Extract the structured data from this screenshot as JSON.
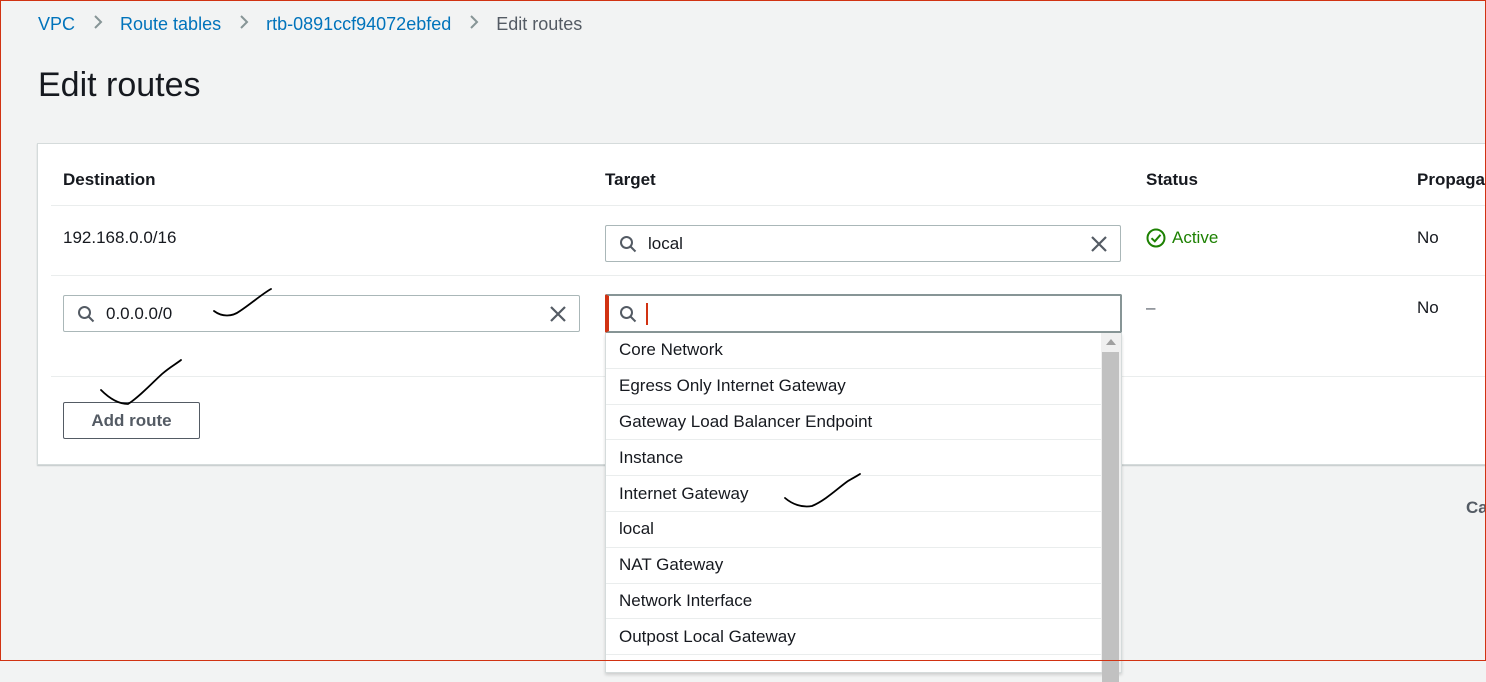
{
  "breadcrumb": {
    "items": [
      "VPC",
      "Route tables",
      "rtb-0891ccf94072ebfed"
    ],
    "current": "Edit routes"
  },
  "page": {
    "title": "Edit routes"
  },
  "table": {
    "headers": {
      "destination": "Destination",
      "target": "Target",
      "status": "Status",
      "propagated": "Propaga"
    },
    "rows": [
      {
        "destination": "192.168.0.0/16",
        "target": "local",
        "status": "Active",
        "propagated": "No"
      },
      {
        "destination": "0.0.0.0/0",
        "target": "",
        "status": "–",
        "propagated": "No"
      }
    ]
  },
  "buttons": {
    "add_route": "Add route",
    "cancel_partial": "Ca"
  },
  "dropdown": {
    "options": [
      "Core Network",
      "Egress Only Internet Gateway",
      "Gateway Load Balancer Endpoint",
      "Instance",
      "Internet Gateway",
      "local",
      "NAT Gateway",
      "Network Interface",
      "Outpost Local Gateway"
    ]
  },
  "colors": {
    "link": "#0073bb",
    "active": "#1d8102",
    "focus_error": "#d13212"
  },
  "icons": {
    "search": "search-icon",
    "clear": "close-icon",
    "status": "check-circle-icon"
  }
}
